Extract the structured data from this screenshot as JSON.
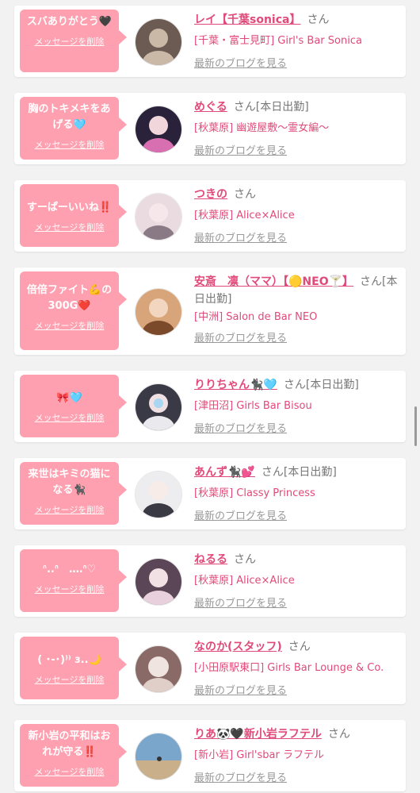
{
  "entries": [
    {
      "message": "スバありがとう🖤",
      "delete_label": "メッセージを削除",
      "name": "レイ【千葉sonica】",
      "suffix": "さん",
      "shop": "[千葉・富士見町] Girl's Bar Sonica",
      "blog_label": "最新のブログを見る",
      "colors": {
        "bg": "#6b5b52",
        "fg": "#cbb9a8"
      }
    },
    {
      "message": "胸のトキメキをあげる🩵",
      "delete_label": "メッセージを削除",
      "name": "めぐる",
      "suffix": "さん[本日出勤]",
      "shop": "[秋葉原] 幽遊屋敷～霊女編～",
      "blog_label": "最新のブログを見る",
      "colors": {
        "bg": "#2a223a",
        "fg": "#d86fb0"
      }
    },
    {
      "message": "すーぱーいいね‼️",
      "delete_label": "メッセージを削除",
      "name": "つきの",
      "suffix": "さん",
      "shop": "[秋葉原] Alice×Alice",
      "blog_label": "最新のブログを見る",
      "colors": {
        "bg": "#e9dbe0",
        "fg": "#8a7a86"
      }
    },
    {
      "message": "倍倍ファイト💪の300G❤️",
      "delete_label": "メッセージを削除",
      "name": "安斎　凛（ママ）【🟡NEO🍸】",
      "suffix": "さん[本日出勤]",
      "shop": "[中洲] Salon de Bar NEO",
      "blog_label": "最新のブログを見る",
      "colors": {
        "bg": "#d8a47a",
        "fg": "#7a4a2a"
      }
    },
    {
      "message": "🎀🩵",
      "delete_label": "メッセージを削除",
      "name": "りりちゃん🐈‍⬛🩵",
      "suffix": "さん[本日出勤]",
      "shop": "[津田沼] Girls Bar Bisou",
      "blog_label": "最新のブログを見る",
      "colors": {
        "bg": "#3a3a46",
        "fg": "#a9d6f0"
      }
    },
    {
      "message": "来世はキミの猫になる🐈‍⬛",
      "delete_label": "メッセージを削除",
      "name": "あんず🐈‍⬛💕",
      "suffix": "さん[本日出勤]",
      "shop": "[秋葉原] Classy Princess",
      "blog_label": "最新のブログを見る",
      "colors": {
        "bg": "#ededf0",
        "fg": "#3a3a44"
      }
    },
    {
      "message": "ᐢ..ᐢ　‥‥ᐢ♡",
      "delete_label": "メッセージを削除",
      "name": "ねるる",
      "suffix": "さん",
      "shop": "[秋葉原] Alice×Alice",
      "blog_label": "最新のブログを見る",
      "colors": {
        "bg": "#5a4656",
        "fg": "#e8d0dc"
      }
    },
    {
      "message": "( ･-･)⁾⁾ з..🌙",
      "delete_label": "メッセージを削除",
      "name": "なのか(スタッフ)",
      "suffix": "さん",
      "shop": "[小田原駅東口] Girls Bar Lounge & Co.",
      "blog_label": "最新のブログを見る",
      "colors": {
        "bg": "#8a6a66",
        "fg": "#f0e4e0"
      }
    },
    {
      "message": "新小岩の平和はおれが守る‼️",
      "delete_label": "メッセージを削除",
      "name": "りあ🐼🖤新小岩ラフテル",
      "suffix": "さん",
      "shop": "[新小岩] Girl'sbar ラフテル",
      "blog_label": "最新のブログを見る",
      "colors": {
        "bg": "#7aa6cc",
        "fg": "#c9b08a"
      }
    }
  ]
}
